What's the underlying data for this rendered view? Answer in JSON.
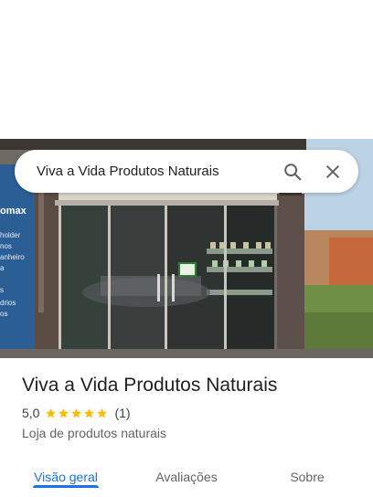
{
  "search": {
    "query": "Viva a Vida Produtos Naturais",
    "search_icon": "search-icon",
    "close_icon": "close-icon"
  },
  "photo": {
    "sign_partial": "omax",
    "shelf_words": [
      "holder",
      "nos",
      "anheiro",
      "a",
      "s",
      "drios",
      "os"
    ]
  },
  "place": {
    "title": "Viva a Vida Produtos Naturais",
    "rating": "5,0",
    "stars": 5,
    "review_count": "(1)",
    "category": "Loja de produtos naturais"
  },
  "tabs": [
    {
      "label": "Visão geral",
      "active": true
    },
    {
      "label": "Avaliações",
      "active": false
    },
    {
      "label": "Sobre",
      "active": false
    }
  ],
  "colors": {
    "accent": "#1a73e8",
    "star": "#fbbc04"
  }
}
